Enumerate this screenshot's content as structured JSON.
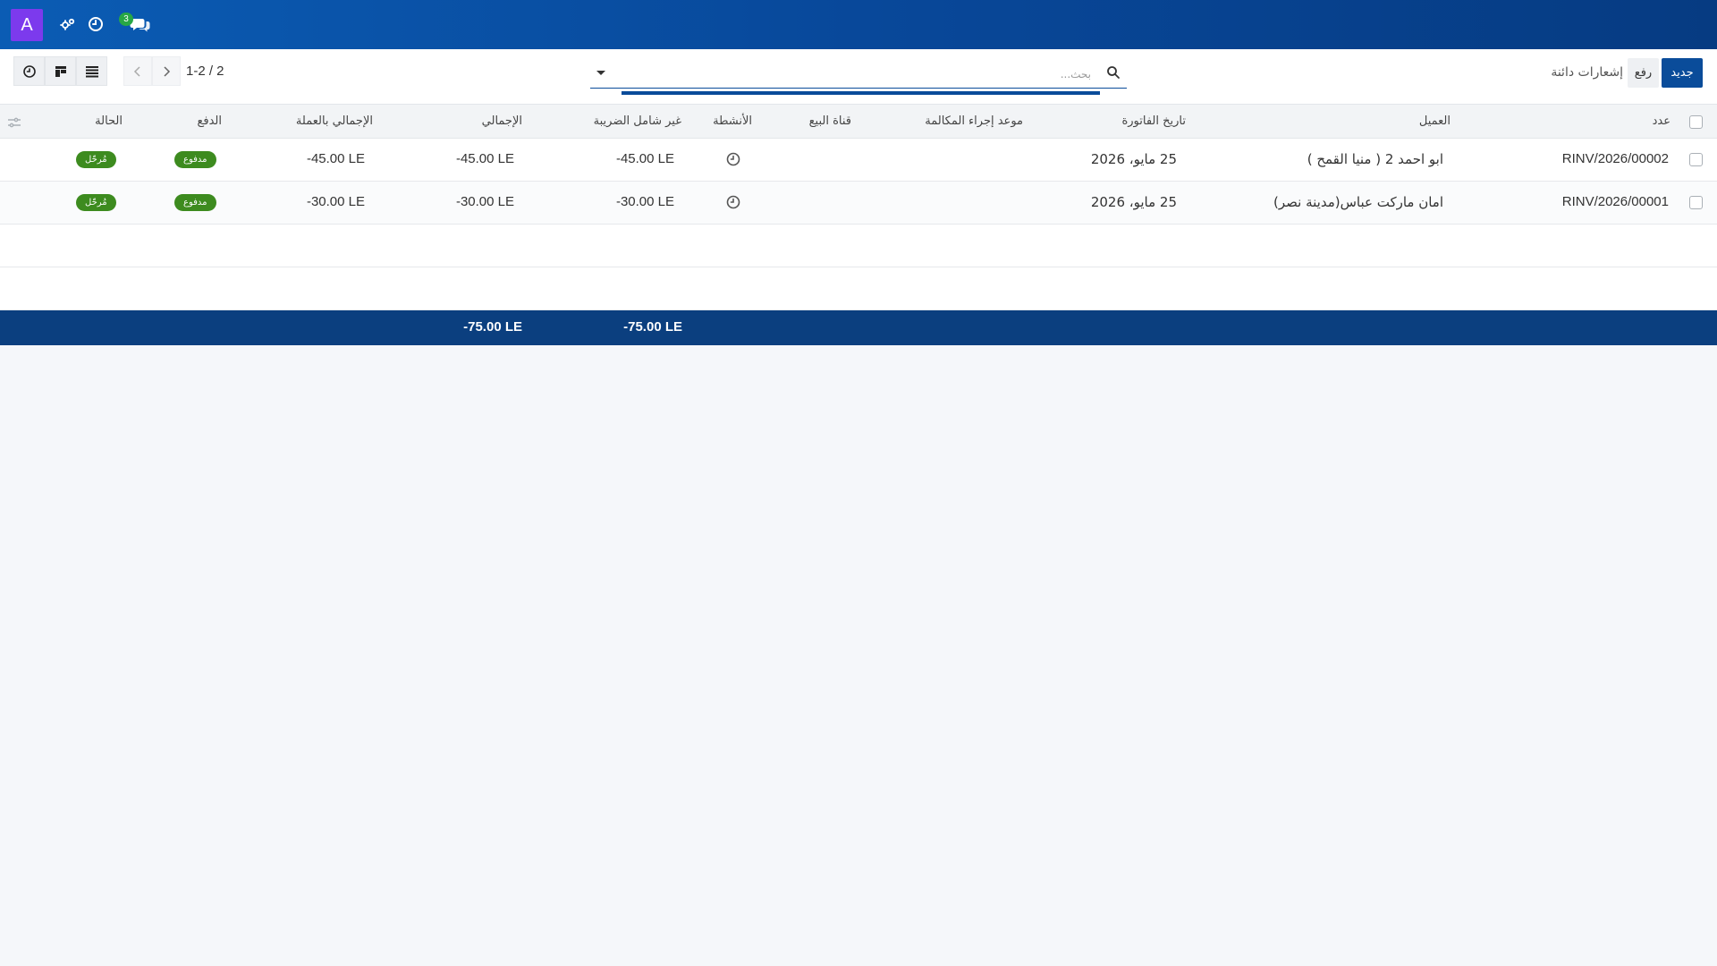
{
  "navbar": {
    "avatar_letter": "A",
    "chat_badge": "3",
    "icons": [
      "settings-gears-icon",
      "clock-icon",
      "chat-icon"
    ],
    "colors": {
      "bar": "#0a4c9a",
      "avatar": "#7c3aed",
      "badge": "#28a745"
    }
  },
  "control": {
    "new_label": "جديد",
    "upload_label": "رفع",
    "breadcrumb": "إشعارات دائنة",
    "search_placeholder": "بحث...",
    "pager_text": "1-2 / 2"
  },
  "table": {
    "headers": {
      "number": "عدد",
      "customer": "العميل",
      "invoice_date": "تاريخ الفاتورة",
      "call_date": "موعد إجراء المكالمة",
      "sales_channel": "قناة البيع",
      "activities": "الأنشطة",
      "untaxed": "غير شامل الضريبة",
      "total": "الإجمالي",
      "total_currency": "الإجمالي بالعملة",
      "payment": "الدفع",
      "status": "الحالة"
    },
    "rows": [
      {
        "number": "RINV/2026/00002",
        "customer": "ابو احمد 2 ( منيا القمح )",
        "invoice_date": "25 مايو، 2026",
        "untaxed": "-45.00 LE",
        "total": "-45.00 LE",
        "total_currency": "-45.00 LE",
        "payment": "مدفوع",
        "status": "مُرحّل"
      },
      {
        "number": "RINV/2026/00001",
        "customer": "امان ماركت عباس(مدينة نصر)",
        "invoice_date": "25 مايو، 2026",
        "untaxed": "-30.00 LE",
        "total": "-30.00 LE",
        "total_currency": "-30.00 LE",
        "payment": "مدفوع",
        "status": "مُرحّل"
      }
    ],
    "totals": {
      "untaxed": "-75.00 LE",
      "total": "-75.00 LE"
    },
    "colors": {
      "footer": "#0b3f7f",
      "badge": "#3d8b1f"
    }
  }
}
